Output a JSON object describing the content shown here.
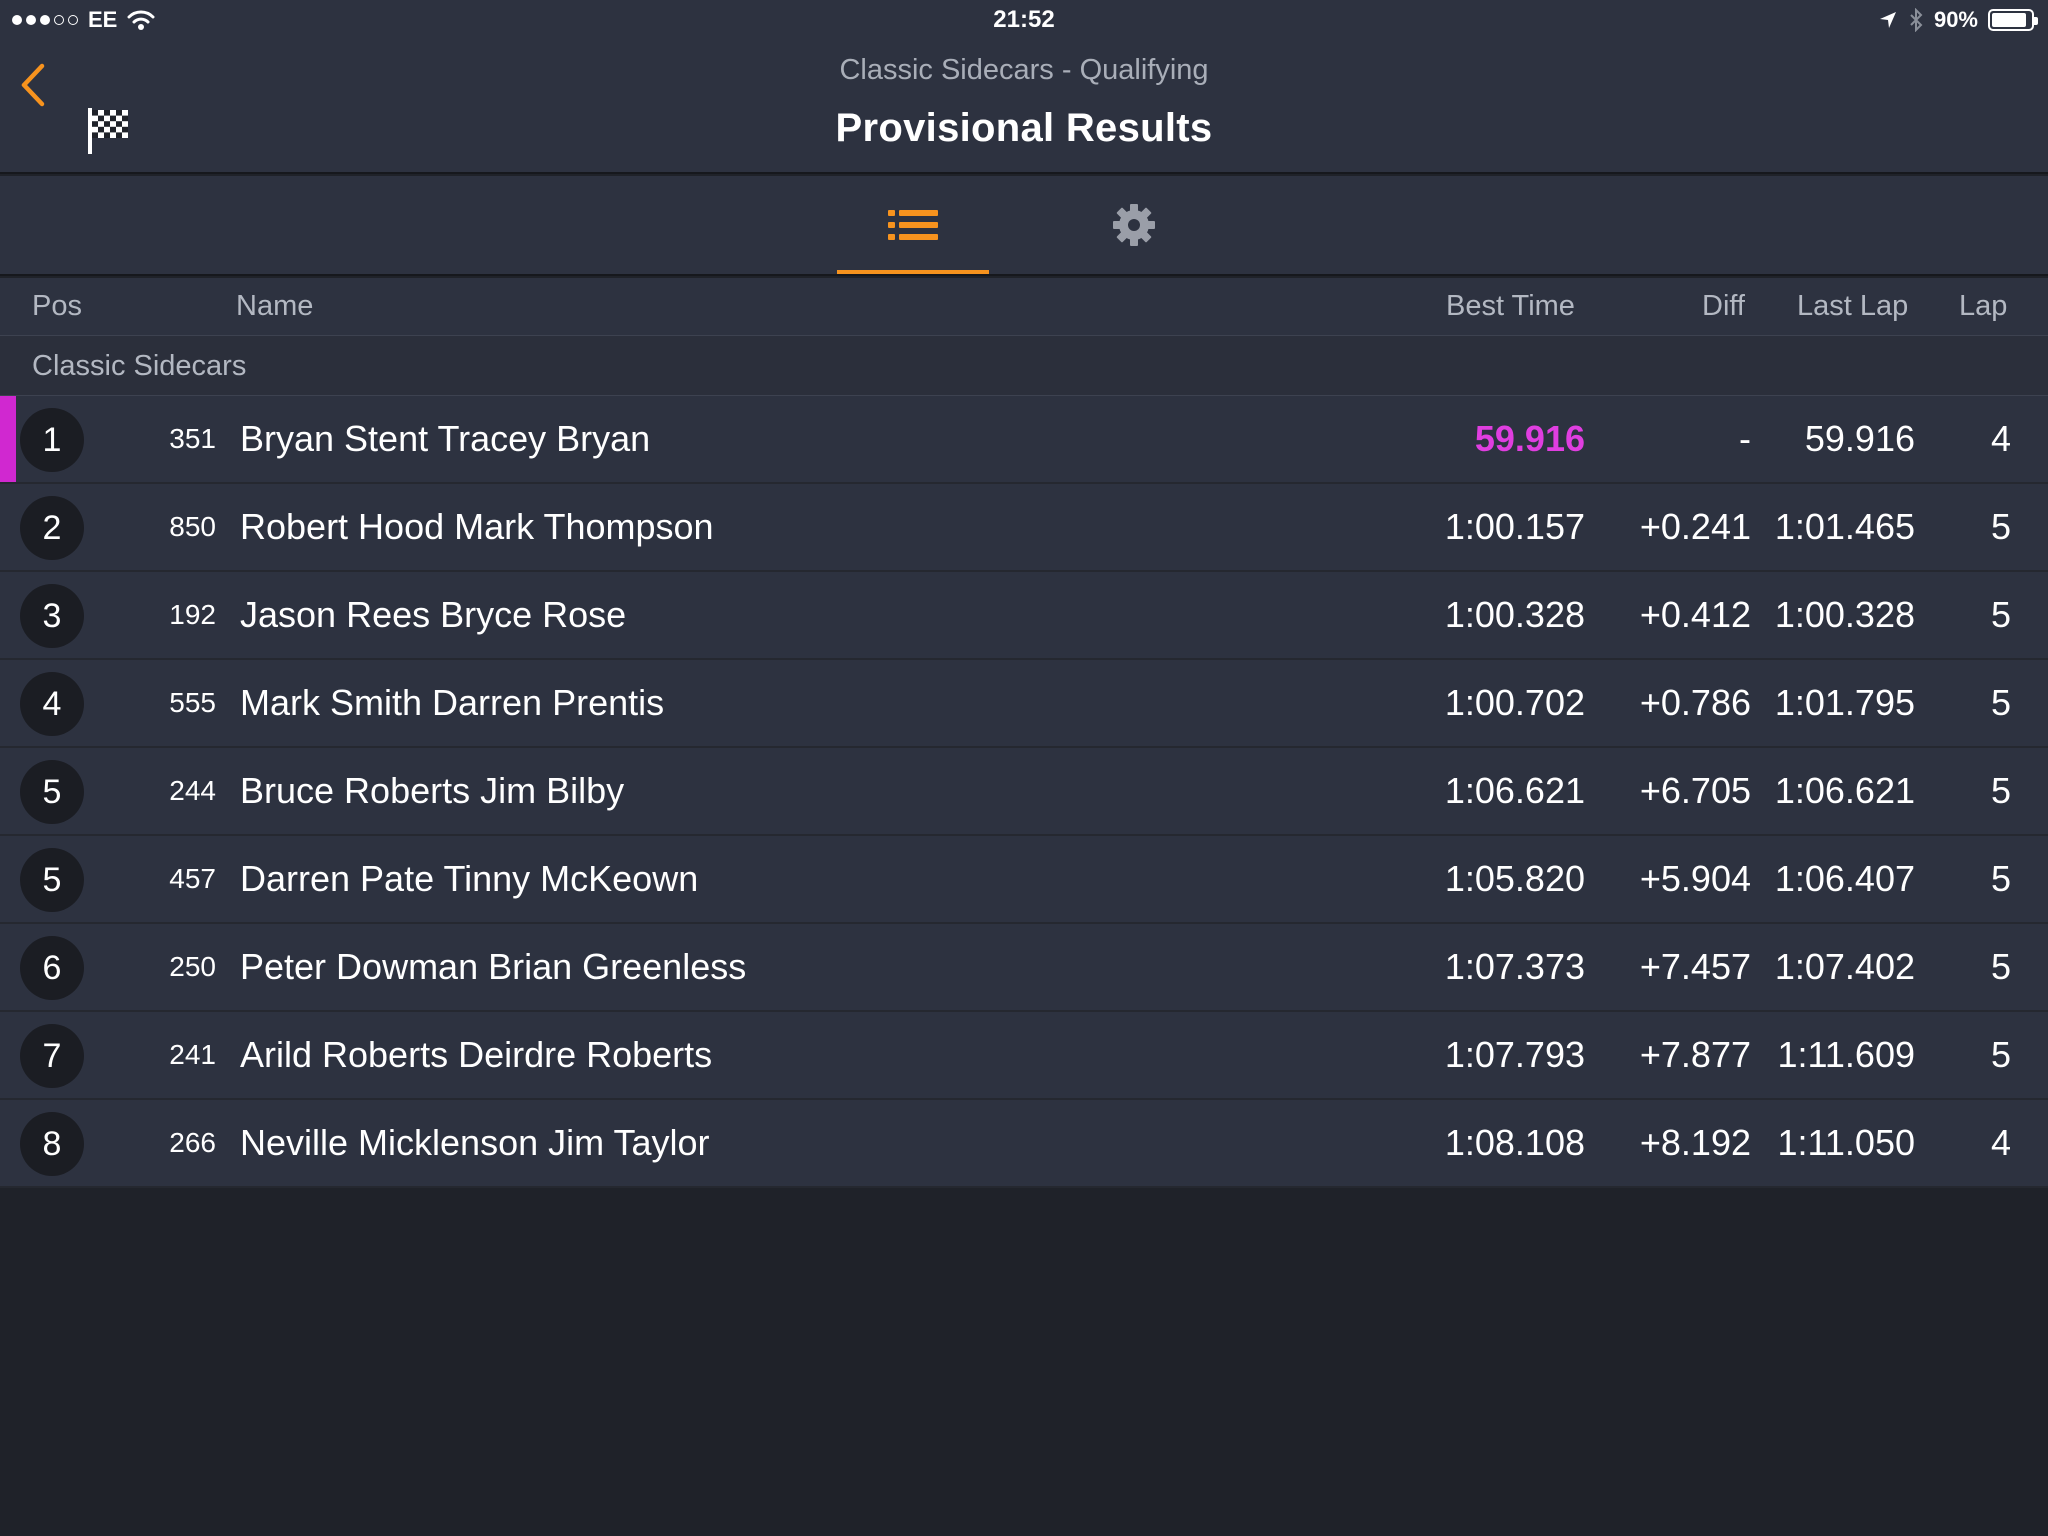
{
  "status_bar": {
    "carrier": "EE",
    "time": "21:52",
    "battery": "90%",
    "battery_level": 0.9,
    "signal_bars_filled": 3,
    "signal_bars_total": 5
  },
  "header": {
    "subtitle": "Classic Sidecars - Qualifying",
    "title": "Provisional Results"
  },
  "tabs": [
    {
      "icon": "list-icon",
      "active": true
    },
    {
      "icon": "gear-icon",
      "active": false
    }
  ],
  "columns": {
    "pos": "Pos",
    "name": "Name",
    "best_time": "Best Time",
    "diff": "Diff",
    "last_lap": "Last Lap",
    "lap": "Lap"
  },
  "group": "Classic Sidecars",
  "colors": {
    "accent": "#f7931e",
    "fastest": "#e03ee0"
  },
  "rows": [
    {
      "pos": "1",
      "number": "351",
      "name": "Bryan Stent Tracey Bryan",
      "best": "59.916",
      "diff": "-",
      "last": "59.916",
      "lap": "4"
    },
    {
      "pos": "2",
      "number": "850",
      "name": "Robert Hood Mark Thompson",
      "best": "1:00.157",
      "diff": "+0.241",
      "last": "1:01.465",
      "lap": "5"
    },
    {
      "pos": "3",
      "number": "192",
      "name": "Jason Rees Bryce Rose",
      "best": "1:00.328",
      "diff": "+0.412",
      "last": "1:00.328",
      "lap": "5"
    },
    {
      "pos": "4",
      "number": "555",
      "name": "Mark Smith Darren Prentis",
      "best": "1:00.702",
      "diff": "+0.786",
      "last": "1:01.795",
      "lap": "5"
    },
    {
      "pos": "5",
      "number": "244",
      "name": "Bruce Roberts Jim Bilby",
      "best": "1:06.621",
      "diff": "+6.705",
      "last": "1:06.621",
      "lap": "5"
    },
    {
      "pos": "5",
      "number": "457",
      "name": "Darren Pate Tinny McKeown",
      "best": "1:05.820",
      "diff": "+5.904",
      "last": "1:06.407",
      "lap": "5"
    },
    {
      "pos": "6",
      "number": "250",
      "name": "Peter Dowman Brian Greenless",
      "best": "1:07.373",
      "diff": "+7.457",
      "last": "1:07.402",
      "lap": "5"
    },
    {
      "pos": "7",
      "number": "241",
      "name": "Arild Roberts Deirdre Roberts",
      "best": "1:07.793",
      "diff": "+7.877",
      "last": "1:11.609",
      "lap": "5"
    },
    {
      "pos": "8",
      "number": "266",
      "name": "Neville Micklenson Jim Taylor",
      "best": "1:08.108",
      "diff": "+8.192",
      "last": "1:11.050",
      "lap": "4"
    }
  ]
}
